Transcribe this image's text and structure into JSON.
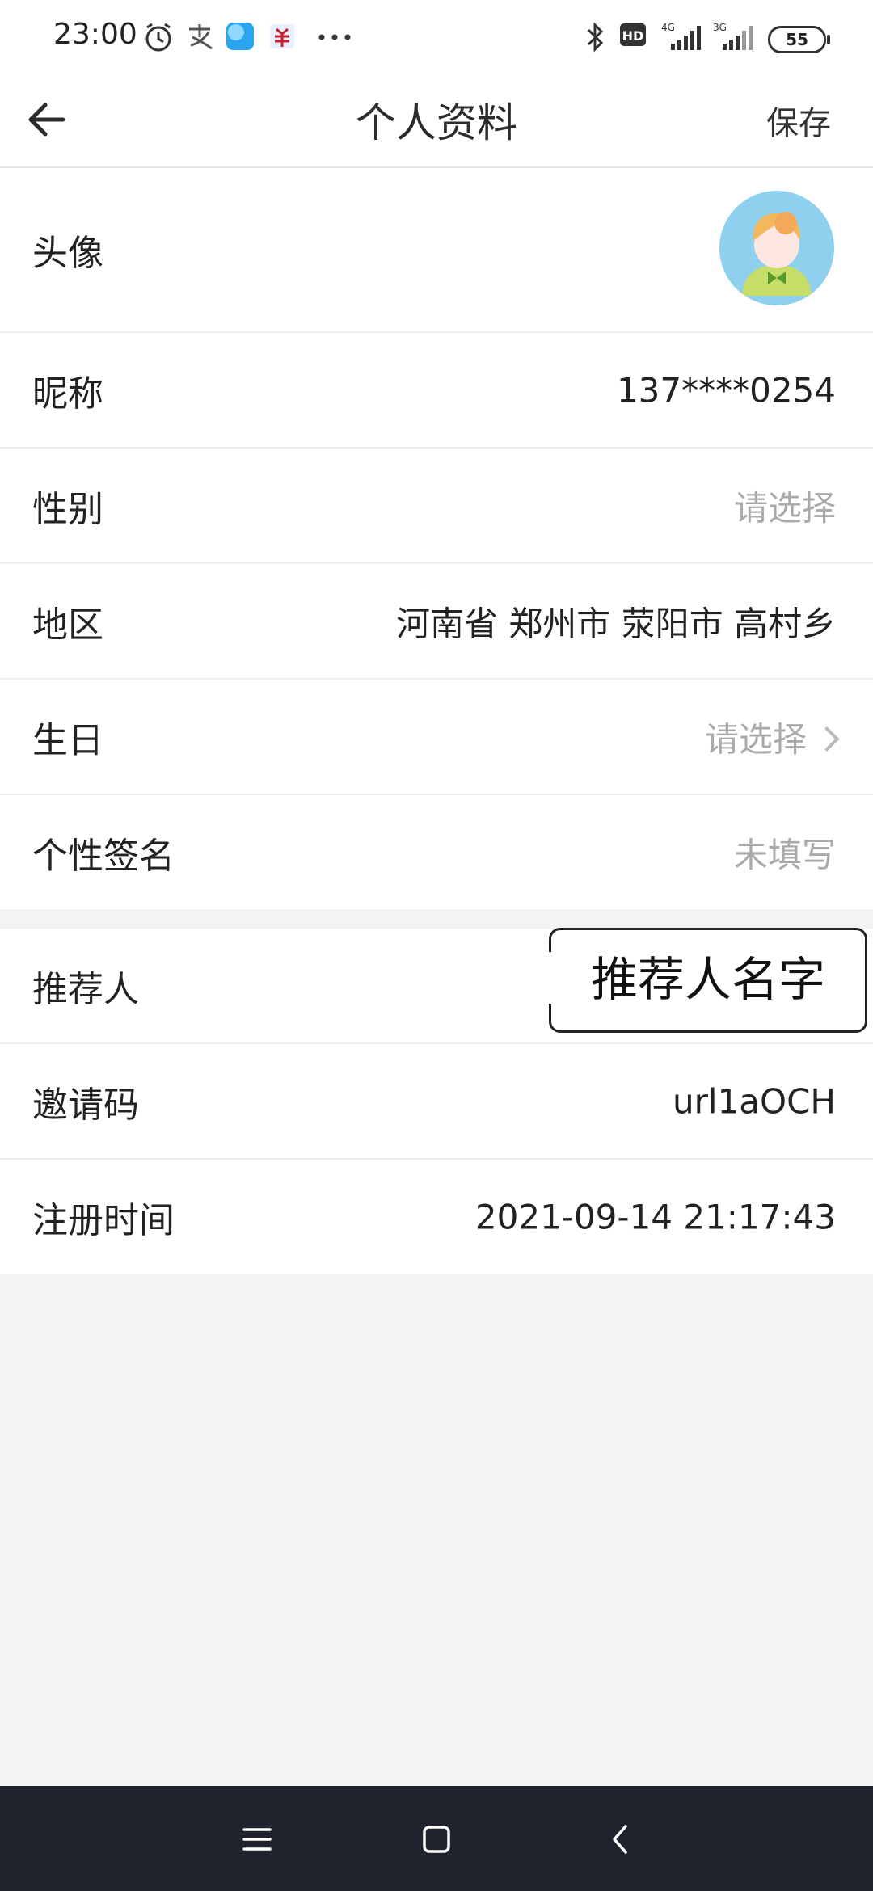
{
  "status_bar": {
    "time": "23:00",
    "battery": "55",
    "icons": [
      "alarm-icon",
      "alipay-icon",
      "app-icon",
      "bank-icon",
      "more-icon",
      "bluetooth-icon",
      "hd-icon",
      "signal-4g-icon",
      "signal-3g-icon"
    ]
  },
  "header": {
    "title": "个人资料",
    "save_label": "保存"
  },
  "profile": {
    "avatar_label": "头像",
    "rows": [
      {
        "label": "昵称",
        "value": "137****0254"
      },
      {
        "label": "性别",
        "value": "请选择"
      },
      {
        "label": "地区",
        "value": "河南省 郑州市 荥阳市 高村乡"
      },
      {
        "label": "生日",
        "value": "请选择"
      },
      {
        "label": "个性签名",
        "value": "未填写"
      }
    ]
  },
  "extra": {
    "rows": [
      {
        "label": "推荐人",
        "value": ""
      },
      {
        "label": "邀请码",
        "value": "url1aOCH"
      },
      {
        "label": "注册时间",
        "value": "2021-09-14 21:17:43"
      }
    ],
    "callout_text": "推荐人名字"
  },
  "colors": {
    "background": "#f3f3f3",
    "nav_bar": "#20232d",
    "placeholder": "#aaaaaa"
  }
}
